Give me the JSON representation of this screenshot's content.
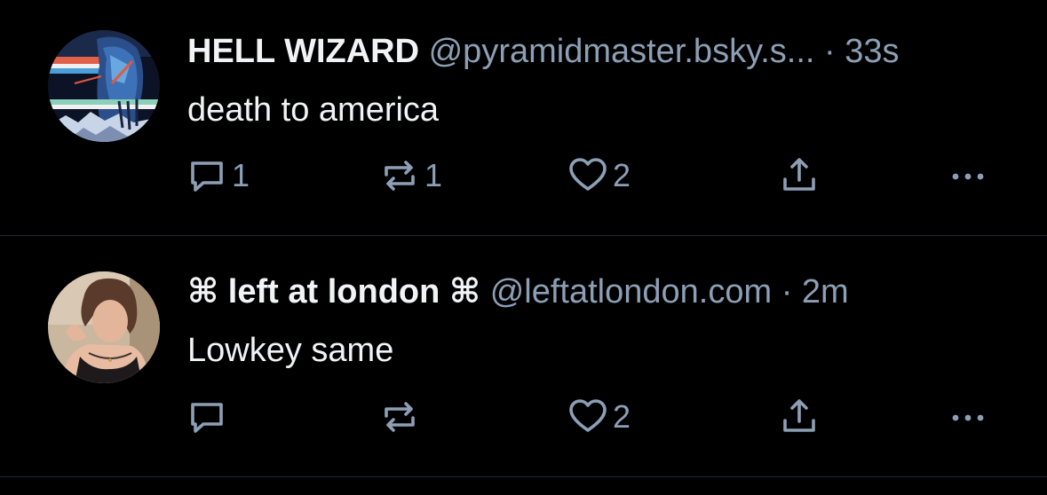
{
  "colors": {
    "background": "#000000",
    "primary_text": "#f1f3f5",
    "secondary_text": "#8c9fb5",
    "divider": "#1e2936"
  },
  "posts": [
    {
      "display_name": "HELL WIZARD",
      "handle": "@pyramidmaster.bsky.s...",
      "separator": "·",
      "timestamp": "33s",
      "text": "death to america",
      "avatar_icon": "fantasy-art-avatar",
      "actions": {
        "reply_count": "1",
        "repost_count": "1",
        "like_count": "2",
        "reply_icon": "reply-icon",
        "repost_icon": "repost-icon",
        "like_icon": "heart-icon",
        "share_icon": "share-icon",
        "more_icon": "more-icon"
      }
    },
    {
      "display_name": "⌘ left at london ⌘",
      "handle": "@leftatlondon.com",
      "separator": "·",
      "timestamp": "2m",
      "text": "Lowkey same",
      "avatar_icon": "portrait-photo-avatar",
      "actions": {
        "reply_count": "",
        "repost_count": "",
        "like_count": "2",
        "reply_icon": "reply-icon",
        "repost_icon": "repost-icon",
        "like_icon": "heart-icon",
        "share_icon": "share-icon",
        "more_icon": "more-icon"
      }
    }
  ]
}
